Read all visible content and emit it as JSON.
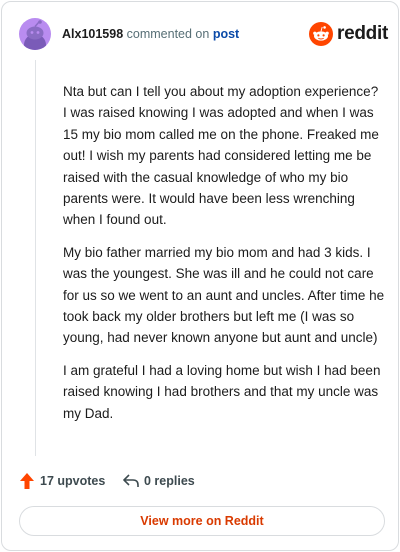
{
  "comment": {
    "username": "Alx101598",
    "commented_on_text": "commented on",
    "post_link_text": "post",
    "paragraphs": [
      "Nta but can I tell you about my adoption experience? I was raised knowing I was adopted and when I was 15 my bio mom called me on the phone. Freaked me out! I wish my parents had considered letting me be raised with the casual knowledge of who my bio parents were. It would have been less wrenching when I found out.",
      "My bio father married my bio mom and had 3 kids. I was the youngest. She was ill and he could not care for us so we went to an aunt and uncles. After time he took back my older brothers but left me (I was so young, had never known anyone but aunt and uncle)",
      "I am grateful I had a loving home but wish I had been raised knowing I had brothers and that my uncle was my Dad."
    ],
    "upvotes_text": "17 upvotes",
    "replies_text": "0 replies"
  },
  "brand": {
    "logo_text": "reddit",
    "icon": "reddit-logo-icon"
  },
  "view_more_label": "View more on Reddit",
  "colors": {
    "accent": "#d93a00",
    "reddit_orange": "#ff4500",
    "avatar_bg": "#b98cf0",
    "link": "#0a4aa8"
  }
}
